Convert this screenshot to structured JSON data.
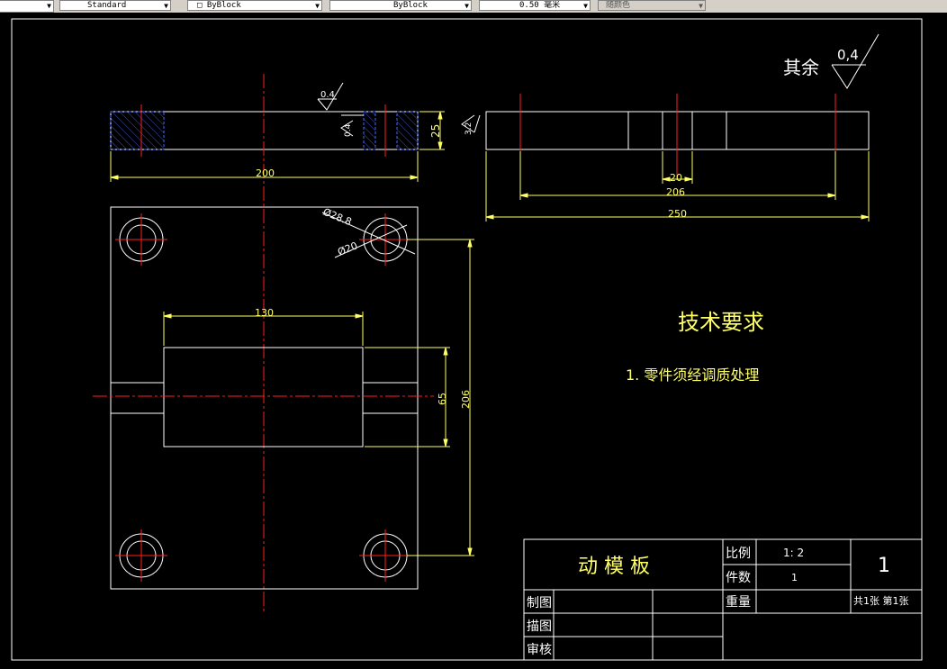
{
  "toolbar": {
    "textstyle": "Standard",
    "linetype": "ByBlock",
    "lineweight_label": "ByBlock",
    "lineweight_value": "0.50 毫米",
    "color": "随颜色"
  },
  "drawing": {
    "roughness_label": "其余",
    "roughness_value": "0,4",
    "roughness_small_1": "0.4",
    "roughness_small_2": "0.4",
    "roughness_small_3": "3.2",
    "dim_thickness": "25",
    "dim_width_top": "200",
    "dim_side_20": "20",
    "dim_side_206": "206",
    "dim_side_250": "250",
    "dim_hole_large": "Ø28.8",
    "dim_hole_small": "Ø20",
    "dim_pocket_width": "130",
    "dim_pocket_height": "65",
    "dim_vertical_206": "206",
    "tech_title": "技术要求",
    "tech_item_1": "1. 零件须经调质处理"
  },
  "title_block": {
    "part_name": "动 模 板",
    "scale_label": "比例",
    "scale_value": "1: 2",
    "count_label": "件数",
    "count_value": "1",
    "weight_label": "重量",
    "drawing_no": "1",
    "sheet_info": "共1张 第1张",
    "drawn_label": "制图",
    "traced_label": "描图",
    "checked_label": "审核"
  }
}
